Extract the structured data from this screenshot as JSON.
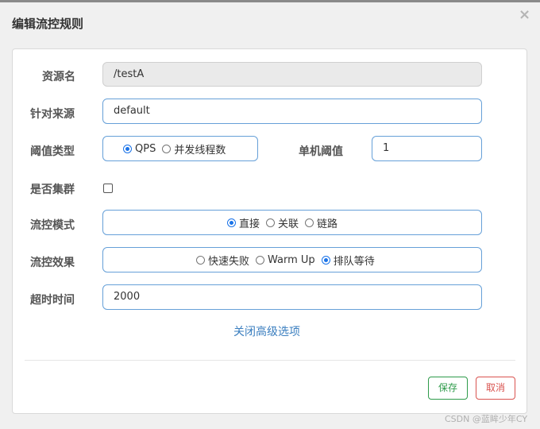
{
  "dialog": {
    "title": "编辑流控规则",
    "close_glyph": "×"
  },
  "form": {
    "resource_name": {
      "label": "资源名",
      "value": "/testA"
    },
    "limit_app": {
      "label": "针对来源",
      "value": "default"
    },
    "threshold_type": {
      "label": "阈值类型",
      "options": [
        {
          "label": "QPS",
          "checked": true
        },
        {
          "label": "并发线程数",
          "checked": false
        }
      ]
    },
    "threshold": {
      "label": "单机阈值",
      "value": "1"
    },
    "cluster": {
      "label": "是否集群",
      "checked": false
    },
    "control_mode": {
      "label": "流控模式",
      "options": [
        {
          "label": "直接",
          "checked": true
        },
        {
          "label": "关联",
          "checked": false
        },
        {
          "label": "链路",
          "checked": false
        }
      ]
    },
    "control_effect": {
      "label": "流控效果",
      "options": [
        {
          "label": "快速失败",
          "checked": false
        },
        {
          "label": "Warm Up",
          "checked": false
        },
        {
          "label": "排队等待",
          "checked": true
        }
      ]
    },
    "timeout": {
      "label": "超时时间",
      "value": "2000"
    },
    "advanced_link": "关闭高级选项"
  },
  "footer": {
    "save_label": "保存",
    "cancel_label": "取消"
  },
  "watermark": "CSDN @蓝眸少年CY",
  "colors": {
    "accent": "#1a73e8",
    "input_border": "#66a0d8",
    "save": "#2e9b4a",
    "cancel": "#d9534f",
    "link": "#3a7ebf"
  }
}
